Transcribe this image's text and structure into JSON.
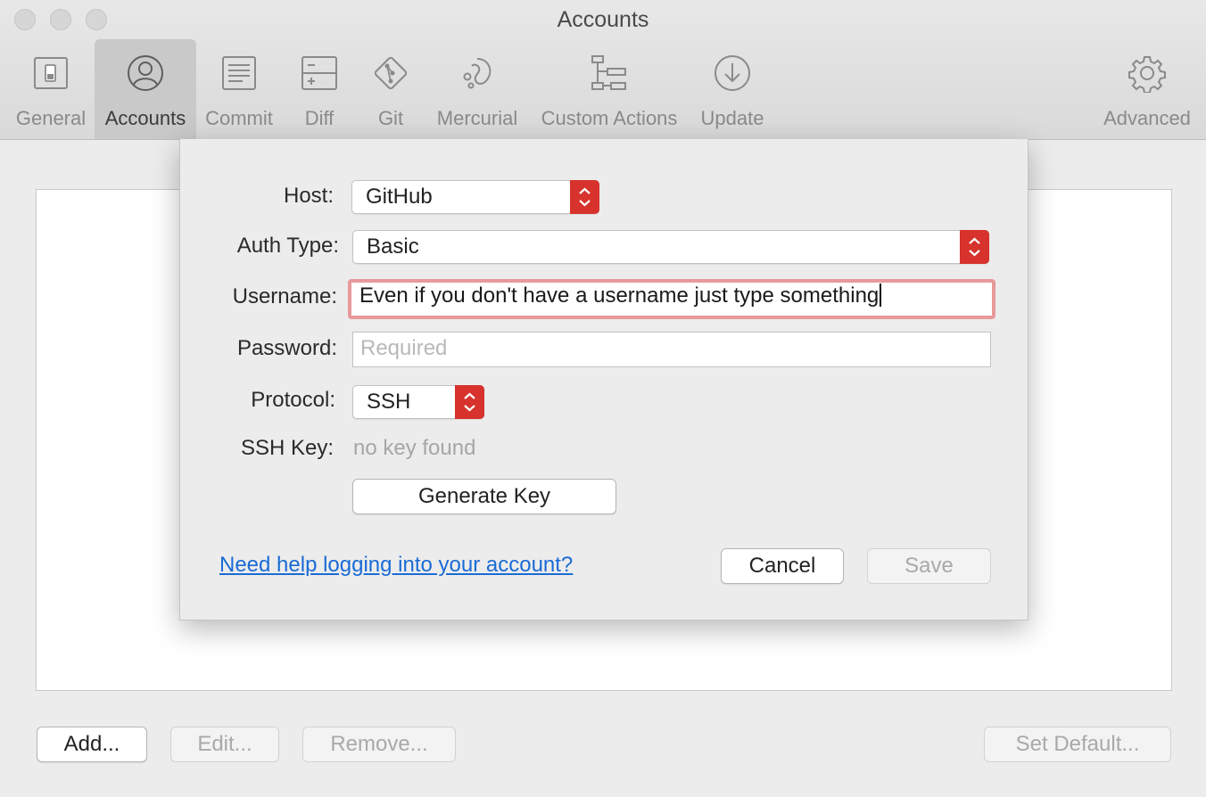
{
  "window": {
    "title": "Accounts"
  },
  "toolbar": {
    "tabs": [
      {
        "label": "General",
        "icon": "general-switch-icon"
      },
      {
        "label": "Accounts",
        "icon": "person-icon",
        "active": true
      },
      {
        "label": "Commit",
        "icon": "commit-text-icon"
      },
      {
        "label": "Diff",
        "icon": "diff-icon"
      },
      {
        "label": "Git",
        "icon": "git-icon"
      },
      {
        "label": "Mercurial",
        "icon": "mercurial-icon"
      },
      {
        "label": "Custom Actions",
        "icon": "custom-actions-icon"
      },
      {
        "label": "Update",
        "icon": "download-arrow-icon"
      },
      {
        "label": "Advanced",
        "icon": "gear-icon"
      }
    ]
  },
  "sheet": {
    "host": {
      "label": "Host:",
      "value": "GitHub"
    },
    "auth_type": {
      "label": "Auth Type:",
      "value": "Basic"
    },
    "username": {
      "label": "Username:",
      "value": "Even if you don't have a username just type something"
    },
    "password": {
      "label": "Password:",
      "placeholder": "Required"
    },
    "protocol": {
      "label": "Protocol:",
      "value": "SSH"
    },
    "ssh_key": {
      "label": "SSH Key:",
      "value": "no key found"
    },
    "generate_key": "Generate Key",
    "help_link": "Need help logging into your account?",
    "cancel": "Cancel",
    "save": "Save"
  },
  "bottom_buttons": {
    "add": "Add...",
    "edit": "Edit...",
    "remove": "Remove...",
    "set_default": "Set Default..."
  },
  "colors": {
    "stepper_red": "#d7322c",
    "focus_ring": "#e8999a",
    "link_blue": "#1a6bd6"
  }
}
